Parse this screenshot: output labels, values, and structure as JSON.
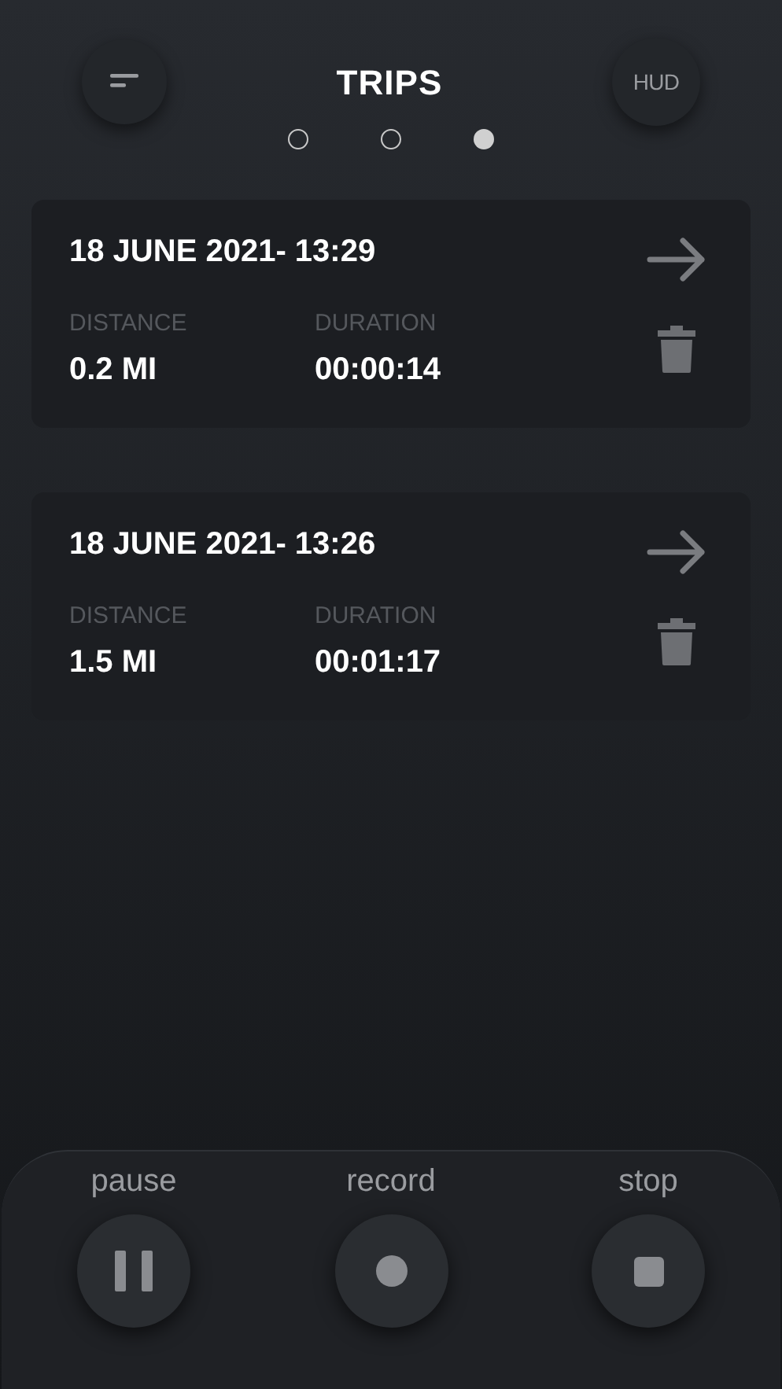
{
  "header": {
    "title": "TRIPS",
    "right_button": "HUD"
  },
  "pager": [
    {
      "selected": false
    },
    {
      "selected": false
    },
    {
      "selected": true
    }
  ],
  "trips": [
    {
      "date": "18 JUNE 2021- 13:29",
      "distance_label": "DISTANCE",
      "distance": "0.2 MI",
      "duration_label": "DURATION",
      "duration": "00:00:14"
    },
    {
      "date": "18 JUNE 2021- 13:26",
      "distance_label": "DISTANCE",
      "distance": "1.5 MI",
      "duration_label": "DURATION",
      "duration": "00:01:17"
    }
  ],
  "controls": [
    {
      "kind": "pause",
      "label": "pause"
    },
    {
      "kind": "record",
      "label": "record"
    },
    {
      "kind": "stop",
      "label": "stop"
    }
  ]
}
